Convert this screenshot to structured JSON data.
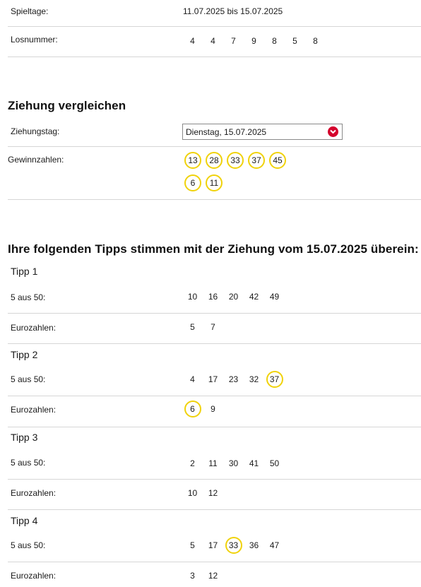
{
  "spieltage": {
    "label": "Spieltage:",
    "value": "11.07.2025 bis 15.07.2025"
  },
  "losnummer": {
    "label": "Losnummer:",
    "digits": [
      "4",
      "4",
      "7",
      "9",
      "8",
      "5",
      "8"
    ]
  },
  "compare": {
    "title": "Ziehung vergleichen",
    "day_label": "Ziehungstag:",
    "day_value": "Dienstag, 15.07.2025",
    "win_label": "Gewinnzahlen:",
    "main_numbers": [
      "13",
      "28",
      "33",
      "37",
      "45"
    ],
    "euro_numbers": [
      "6",
      "11"
    ]
  },
  "tips_title": "Ihre folgenden Tipps stimmen mit der Ziehung vom 15.07.2025 überein:",
  "main_label": "5 aus 50:",
  "euro_label": "Eurozahlen:",
  "tips": [
    {
      "name": "Tipp 1",
      "main": [
        "10",
        "16",
        "20",
        "42",
        "49"
      ],
      "euro": [
        "5",
        "7"
      ]
    },
    {
      "name": "Tipp 2",
      "main": [
        "4",
        "17",
        "23",
        "32",
        "37"
      ],
      "euro": [
        "6",
        "9"
      ]
    },
    {
      "name": "Tipp 3",
      "main": [
        "2",
        "11",
        "30",
        "41",
        "50"
      ],
      "euro": [
        "10",
        "12"
      ]
    },
    {
      "name": "Tipp 4",
      "main": [
        "5",
        "17",
        "33",
        "36",
        "47"
      ],
      "euro": [
        "3",
        "12"
      ]
    }
  ],
  "colors": {
    "highlight": "#f0d20a",
    "accent": "#d4002c",
    "divider": "#d6d6d6"
  }
}
